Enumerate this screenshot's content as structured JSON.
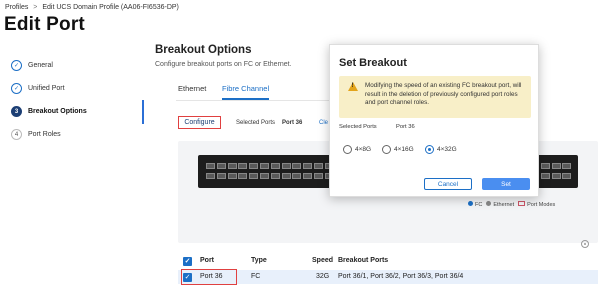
{
  "breadcrumb": {
    "root": "Profiles",
    "separator": ">",
    "current": "Edit UCS Domain Profile (AA06-FI6536-DP)"
  },
  "page_title": "Edit Port",
  "steps": [
    {
      "num": "✓",
      "label": "General",
      "state": "done"
    },
    {
      "num": "✓",
      "label": "Unified Port",
      "state": "done"
    },
    {
      "num": "3",
      "label": "Breakout Options",
      "state": "active"
    },
    {
      "num": "4",
      "label": "Port Roles",
      "state": "pending"
    }
  ],
  "section": {
    "title": "Breakout Options",
    "subtitle": "Configure breakout ports on FC or Ethernet."
  },
  "tabs": [
    {
      "label": "Ethernet"
    },
    {
      "label": "Fibre Channel"
    }
  ],
  "toolbar": {
    "configure_label": "Configure",
    "selected_ports_label": "Selected Ports",
    "selected_ports_value": "Port 36",
    "clear_label": "Cle"
  },
  "legend": {
    "fc": "FC",
    "ethernet": "Ethernet",
    "port_modes": "Port Modes"
  },
  "colors": {
    "accent": "#1c6fc6",
    "highlight": "#e04040",
    "warning": "#f8efc8",
    "fc": "#1c6fc6",
    "ethernet": "#888888"
  },
  "table": {
    "headers": {
      "port": "Port",
      "type": "Type",
      "speed": "Speed",
      "breakout": "Breakout Ports"
    },
    "rows": [
      {
        "port": "Port 36",
        "type": "FC",
        "speed": "32G",
        "breakout": "Port 36/1, Port 36/2, Port 36/3, Port 36/4"
      }
    ]
  },
  "modal": {
    "title": "Set Breakout",
    "warning": "Modifying the speed of an existing FC breakout port, will result in the deletion of previously configured port roles and port channel roles.",
    "selected_ports_label": "Selected Ports",
    "selected_ports_value": "Port 36",
    "options": [
      "4×8G",
      "4×16G",
      "4×32G"
    ],
    "selected_option": "4×32G",
    "cancel_label": "Cancel",
    "set_label": "Set"
  }
}
